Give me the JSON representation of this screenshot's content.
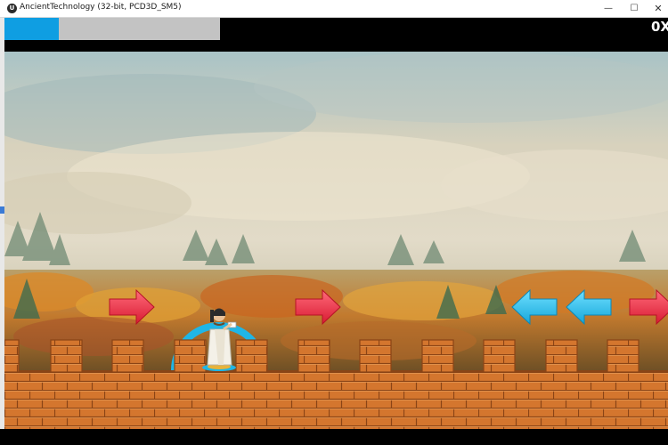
{
  "window": {
    "title": "AncientTechnology (32-bit, PCD3D_SM5)",
    "icon": "unreal-logo-icon",
    "minimize_glyph": "—",
    "maximize_glyph": "☐",
    "close_glyph": "✕"
  },
  "hud": {
    "progress_fraction": 0.25,
    "score": "0X",
    "progress_color": "#0f9ee2",
    "track_color": "#c3c3c3"
  },
  "scene": {
    "background": "misty-autumn-forest",
    "wall_color": "#d4762e",
    "player": "robed-scholar-character",
    "player_ring_color": "#1fb6e6",
    "arrows": [
      {
        "direction": "right",
        "color": "red"
      },
      {
        "direction": "right",
        "color": "red"
      },
      {
        "direction": "left",
        "color": "blue"
      },
      {
        "direction": "left",
        "color": "blue"
      },
      {
        "direction": "right",
        "color": "red"
      }
    ]
  }
}
